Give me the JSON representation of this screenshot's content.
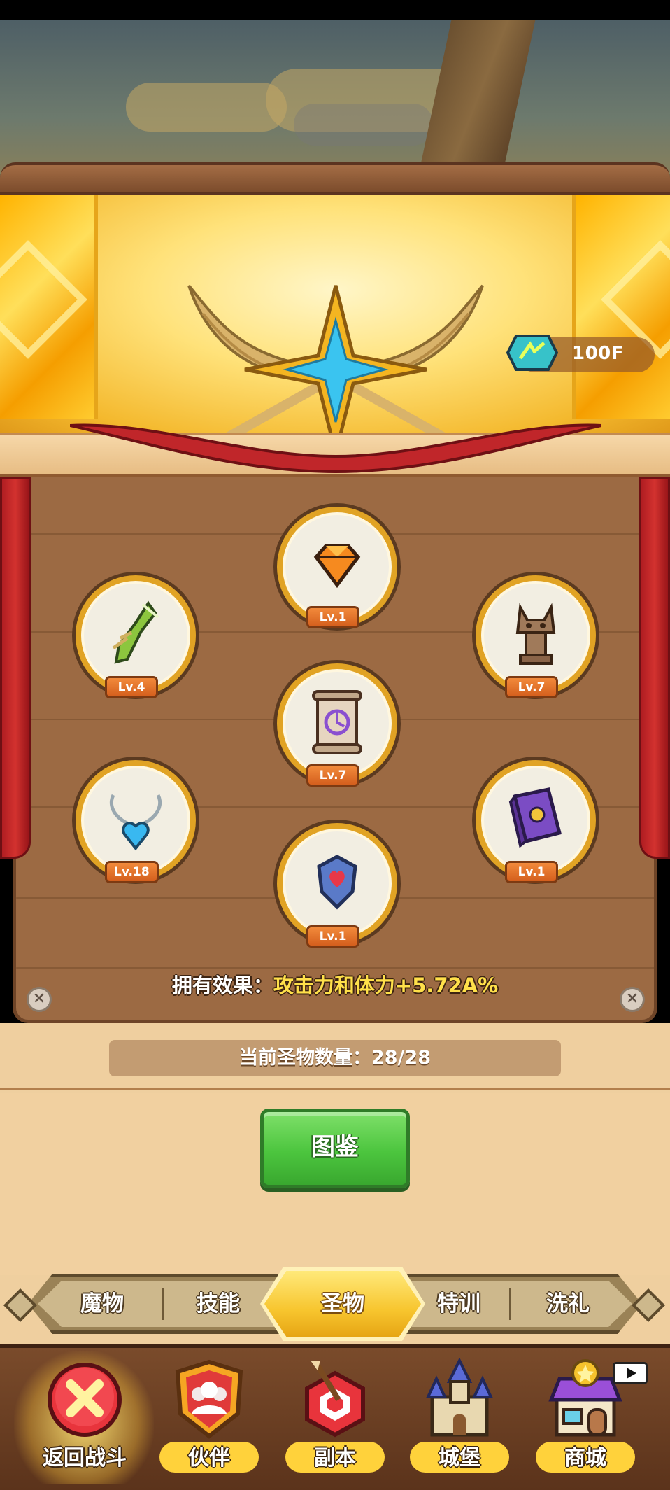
{
  "currency": {
    "value": "100F"
  },
  "relics": [
    {
      "name": "orange-gem",
      "level": "Lv.1"
    },
    {
      "name": "green-claw",
      "level": "Lv.4"
    },
    {
      "name": "horned-totem",
      "level": "Lv.7"
    },
    {
      "name": "purple-scroll",
      "level": "Lv.7"
    },
    {
      "name": "heart-pendant",
      "level": "Lv.18"
    },
    {
      "name": "purple-book",
      "level": "Lv.1"
    },
    {
      "name": "heart-shield",
      "level": "Lv.1"
    }
  ],
  "effect": {
    "label": "拥有效果：",
    "value": "攻击力和体力+5.72A%"
  },
  "relic_count": {
    "text": "当前圣物数量：28/28"
  },
  "codex_button": "图鉴",
  "tabs": [
    {
      "label": "魔物",
      "active": false
    },
    {
      "label": "技能",
      "active": false
    },
    {
      "label": "圣物",
      "active": true
    },
    {
      "label": "特训",
      "active": false
    },
    {
      "label": "洗礼",
      "active": false
    }
  ],
  "nav": [
    {
      "label": "返回战斗"
    },
    {
      "label": "伙伴"
    },
    {
      "label": "副本"
    },
    {
      "label": "城堡"
    },
    {
      "label": "商城"
    }
  ],
  "colors": {
    "accent_gold": "#f7c52e",
    "button_green": "#4cc53e",
    "level_badge": "#d45f1d",
    "curtain_red": "#c62b2b"
  }
}
